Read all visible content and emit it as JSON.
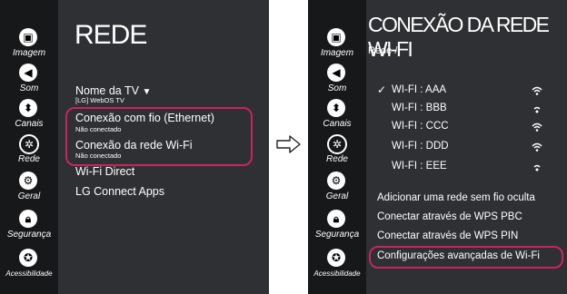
{
  "left_screen": {
    "title": "REDE",
    "menu": {
      "tv_name_label": "Nome da TV",
      "tv_name_value": "[LG] WebOS TV",
      "wired_label": "Conexão com fio (Ethernet)",
      "wired_status": "Não conectado",
      "wifi_label": "Conexão da rede Wi-Fi",
      "wifi_status": "Não conectado",
      "wifi_direct": "Wi-Fi Direct",
      "lg_connect": "LG Connect Apps"
    }
  },
  "right_screen": {
    "title": "CONEXÃO DA REDE WI-FI",
    "breadcrumb": "Rede /",
    "networks": [
      {
        "name": "WI-FI : AAA",
        "connected": true
      },
      {
        "name": "WI-FI : BBB",
        "connected": false
      },
      {
        "name": "WI-FI : CCC",
        "connected": false
      },
      {
        "name": "WI-FI : DDD",
        "connected": false
      },
      {
        "name": "WI-FI : EEE",
        "connected": false
      }
    ],
    "actions": {
      "add_hidden": "Adicionar uma rede sem fio oculta",
      "wps_pbc": "Conectar através de WPS PBC",
      "wps_pin": "Conectar através de WPS PIN",
      "advanced": "Configurações avançadas de Wi-Fi"
    }
  },
  "sidebar": {
    "items": [
      {
        "label": "Imagem",
        "icon": "image-icon",
        "active": false
      },
      {
        "label": "Som",
        "icon": "speaker-icon",
        "active": false
      },
      {
        "label": "Canais",
        "icon": "channels-icon",
        "active": false
      },
      {
        "label": "Rede",
        "icon": "network-icon",
        "active": true
      },
      {
        "label": "Geral",
        "icon": "gear-icon",
        "active": false
      },
      {
        "label": "Segurança",
        "icon": "lock-icon",
        "active": false
      },
      {
        "label": "Acessibilidade",
        "icon": "accessibility-icon",
        "active": false
      }
    ]
  },
  "colors": {
    "highlight": "#c9255a",
    "panel": "#2f3033",
    "rail": "#16181a"
  }
}
